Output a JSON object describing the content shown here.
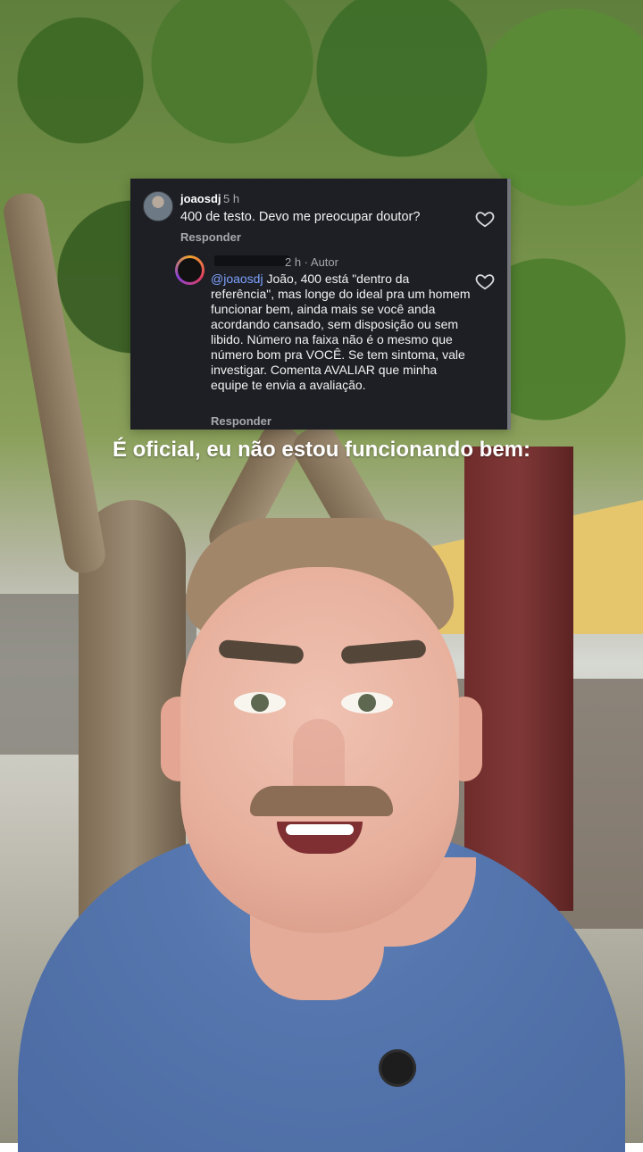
{
  "card": {
    "username": "joaosdj",
    "time": "5 h",
    "comment": "400 de testo. Devo me preocupar doutor?",
    "reply_label": "Responder",
    "reply_meta": "2 h · Autor",
    "reply_mention": "@joaosdj",
    "reply_text": "João, 400 está \"dentro da referência\", mas longe do ideal pra um homem funcionar bem, ainda mais se você anda acordando cansado, sem disposição ou sem libido. Número na faixa não é o mesmo que número bom pra VOCÊ. Se tem sintoma, vale investigar. Comenta AVALIAR que minha equipe te envia a avaliação.",
    "reply_label_2": "Responder"
  },
  "caption": "É oficial, eu não estou funcionando bem:",
  "colors": {
    "card_background": "#1d1f24",
    "mention": "#7ea3ff",
    "caption_text": "#ffffff"
  },
  "icons": {
    "heart": "heart-icon"
  }
}
